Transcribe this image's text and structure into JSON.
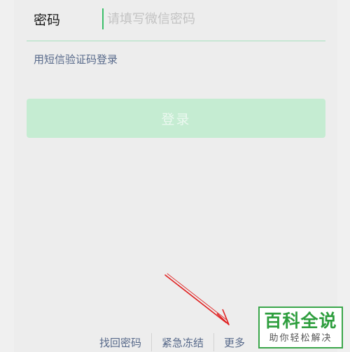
{
  "form": {
    "password_label": "密码",
    "password_placeholder": "请填写微信密码",
    "sms_login_link": "用短信验证码登录",
    "login_button": "登录"
  },
  "footer": {
    "links": [
      "找回密码",
      "紧急冻结",
      "更多"
    ]
  },
  "watermark": {
    "title": "百科全说",
    "subtitle": "助你轻松解决"
  },
  "colors": {
    "accent": "#07c160",
    "link": "#57698a",
    "button_disabled": "#c5ecd2",
    "annotation_arrow": "#e02020"
  }
}
